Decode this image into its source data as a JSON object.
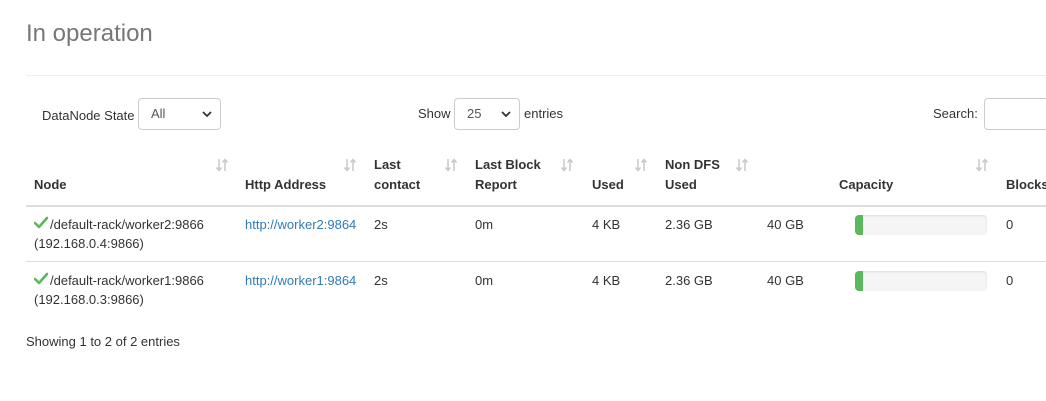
{
  "section_title": "In operation",
  "controls": {
    "state_label": "DataNode State",
    "state_value": "All",
    "show_label": "Show",
    "show_value": "25",
    "entries_label": "entries",
    "search_label": "Search:",
    "search_value": ""
  },
  "table": {
    "headers": {
      "node": "Node",
      "http_address": "Http Address",
      "last_contact_1": "Last",
      "last_contact_2": "contact",
      "last_block_1": "Last Block",
      "last_block_2": "Report",
      "used": "Used",
      "non_dfs_1": "Non DFS",
      "non_dfs_2": "Used",
      "capacity": "Capacity",
      "blocks": "Blocks"
    },
    "rows": [
      {
        "node": "/default-rack/worker2:9866",
        "node_ip": "(192.168.0.4:9866)",
        "http_address": "http://worker2:9864",
        "last_contact": "2s",
        "last_block_report": "0m",
        "used": "4 KB",
        "non_dfs_used": "2.36 GB",
        "capacity": "40 GB",
        "capacity_fraction": 0.06,
        "blocks": "0"
      },
      {
        "node": "/default-rack/worker1:9866",
        "node_ip": "(192.168.0.3:9866)",
        "http_address": "http://worker1:9864",
        "last_contact": "2s",
        "last_block_report": "0m",
        "used": "4 KB",
        "non_dfs_used": "2.36 GB",
        "capacity": "40 GB",
        "capacity_fraction": 0.06,
        "blocks": "0"
      }
    ]
  },
  "info_text": "Showing 1 to 2 of 2 entries",
  "colors": {
    "link": "#337ab7",
    "check": "#5cb85c",
    "progress_fill": "#5cb85c",
    "title": "#777777"
  },
  "icons": [
    "check-icon",
    "sort-icon",
    "chevron-down-icon"
  ]
}
